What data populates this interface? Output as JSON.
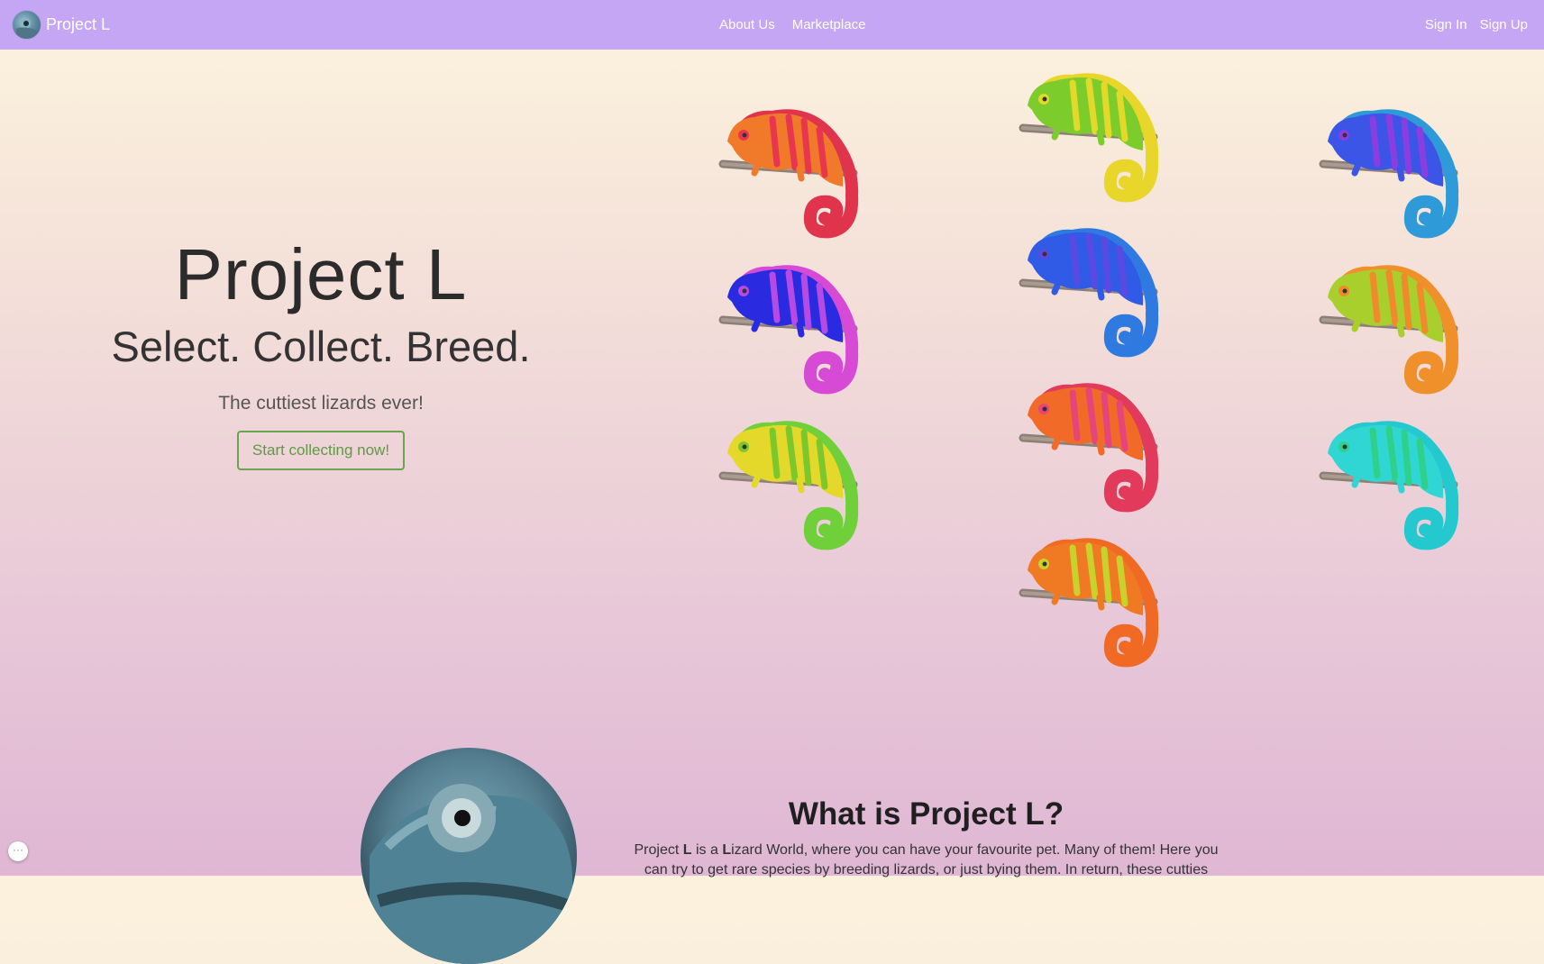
{
  "nav": {
    "brand": "Project L",
    "links": [
      "About Us",
      "Marketplace"
    ],
    "auth": [
      "Sign In",
      "Sign Up"
    ]
  },
  "hero": {
    "title": "Project L",
    "tagline": "Select. Collect. Breed.",
    "subtitle": "The cuttiest lizards ever!",
    "cta": "Start collecting now!"
  },
  "lizards": [
    {
      "name": "orange-red",
      "body": "#f07a2a",
      "stripe": "#e8364f",
      "tail": "#e0344d"
    },
    {
      "name": "green-yellow",
      "body": "#7ccd2b",
      "stripe": "#e3d92a",
      "tail": "#e8d62a"
    },
    {
      "name": "blue-purple",
      "body": "#3b55e6",
      "stripe": "#8a3de0",
      "tail": "#2f9ad8"
    },
    {
      "name": "blue-magenta",
      "body": "#2a2ae0",
      "stripe": "#b64ae5",
      "tail": "#d64ad6"
    },
    {
      "name": "blue",
      "body": "#2f5be6",
      "stripe": "#5a4ae2",
      "tail": "#2f7ae0"
    },
    {
      "name": "green-orange",
      "body": "#a9cf2c",
      "stripe": "#f08a2a",
      "tail": "#f0902a"
    },
    {
      "name": "yellow-green",
      "body": "#e4d92a",
      "stripe": "#7cc82c",
      "tail": "#6fd03a"
    },
    {
      "name": "orange-pink",
      "body": "#f26a28",
      "stripe": "#e5457a",
      "tail": "#e23a5a"
    },
    {
      "name": "teal",
      "body": "#2fd6d4",
      "stripe": "#2fd08a",
      "tail": "#24c9d0"
    },
    {
      "name": "orange-yellow",
      "body": "#f07a24",
      "stripe": "#c9d22a",
      "tail": "#f06a24"
    }
  ],
  "about": {
    "title": "What is Project L?",
    "text_parts": [
      "Project ",
      "L",
      " is a ",
      "L",
      "izard World, where you can have your favourite pet. Many of them! Here you can try to get rare species by breeding lizards, or just bying them. In return, these cutties"
    ]
  },
  "chat": {
    "label": "···"
  }
}
